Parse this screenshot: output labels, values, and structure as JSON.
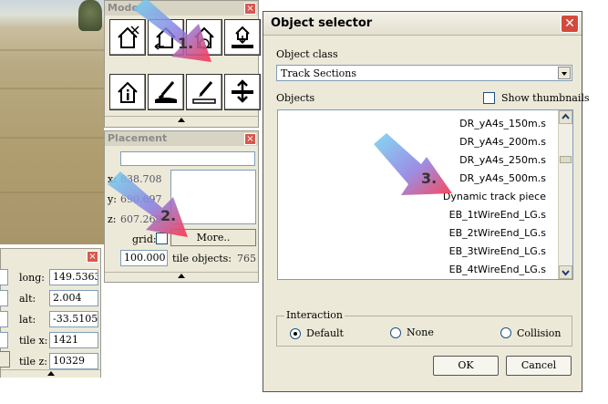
{
  "mode_panel": {
    "title": "Mode",
    "close_glyph": "×",
    "tool_icons": [
      "house-select-icon",
      "house-move-icon",
      "house-rotate-icon",
      "terrain-place-icon",
      "house-info-icon",
      "terrain-brush-icon",
      "terrain-pen-icon",
      "terrain-raise-icon"
    ]
  },
  "placement_panel": {
    "title": "Placement",
    "x_label": "x:",
    "x_value": "838.708",
    "y_label": "y:",
    "y_value": "690.697",
    "z_label": "z:",
    "z_value": "607.269",
    "grid_label": "grid:",
    "more_button": "More..",
    "grid_value": "100.000",
    "tile_objects_label": "tile objects:",
    "tile_objects_value": "765"
  },
  "coords_panel": {
    "long_label": "long:",
    "long_value": "149.5363",
    "alt_label": "alt:",
    "alt_value": "2.004",
    "lat_label": "lat:",
    "lat_value": "-33.5105",
    "tile_x_label": "tile x:",
    "tile_x_value": "1421",
    "tile_z_label": "tile z:",
    "tile_z_value": "10329"
  },
  "dialog": {
    "title": "Object selector",
    "close_glyph": "✕",
    "object_class_label": "Object class",
    "object_class_value": "Track Sections",
    "objects_label": "Objects",
    "show_thumbnails_label": "Show thumbnails",
    "objects": [
      "DR_yA4s_150m.s",
      "DR_yA4s_200m.s",
      "DR_yA4s_250m.s",
      "DR_yA4s_500m.s",
      "Dynamic track piece",
      "EB_1tWireEnd_LG.s",
      "EB_2tWireEnd_LG.s",
      "EB_3tWireEnd_LG.s",
      "EB_4tWireEnd_LG.s"
    ],
    "interaction_label": "Interaction",
    "interaction_options": [
      "Default",
      "None",
      "Collision"
    ],
    "interaction_selected": "Default",
    "ok_button": "OK",
    "cancel_button": "Cancel"
  },
  "annotations": {
    "step1": "1.",
    "step2": "2.",
    "step3": "3."
  }
}
